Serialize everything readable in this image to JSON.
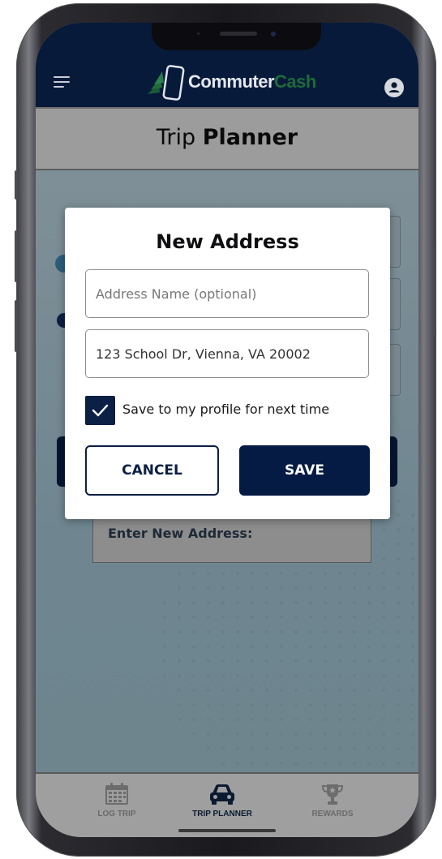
{
  "app": {
    "logo_primary": "Commuter",
    "logo_secondary": "Cash",
    "page_title_light": "Trip",
    "page_title_bold": "Planner"
  },
  "background": {
    "enter_new_address_label": "Enter New Address:"
  },
  "modal": {
    "title": "New Address",
    "address_name_placeholder": "Address Name (optional)",
    "address_name_value": "",
    "address_value": "123 School Dr, Vienna, VA 20002",
    "save_checkbox_checked": true,
    "save_checkbox_label": "Save to my profile for next time",
    "cancel_label": "CANCEL",
    "save_label": "SAVE"
  },
  "tabs": [
    {
      "label": "LOG TRIP",
      "icon": "calendar-icon",
      "active": false
    },
    {
      "label": "TRIP PLANNER",
      "icon": "car-icon",
      "active": true
    },
    {
      "label": "REWARDS",
      "icon": "trophy-icon",
      "active": false
    }
  ],
  "colors": {
    "primary_navy": "#061b43",
    "brand_green": "#1f6b3a",
    "overlay_gray": "#9c9c9c"
  }
}
